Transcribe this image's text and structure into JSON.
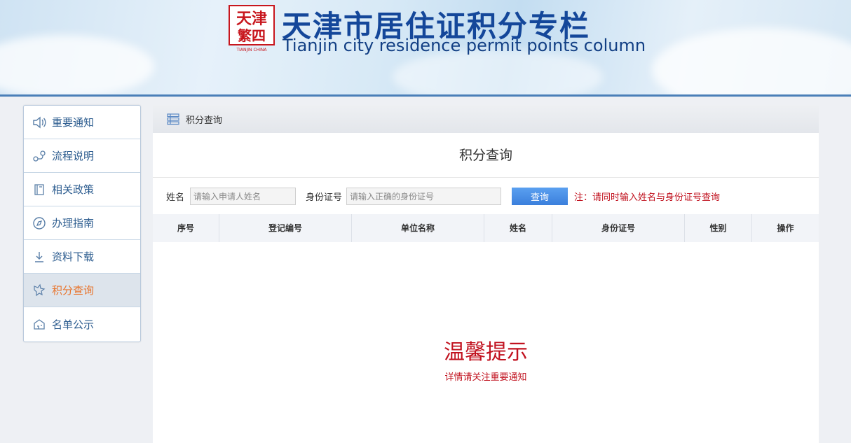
{
  "header": {
    "logo_text_top": "天津",
    "logo_text_mid": "繁四",
    "logo_text_bottom": "TIANJIN CHINA",
    "title_cn": "天津市居住证积分专栏",
    "title_en": "Tianjin city residence permit points column"
  },
  "sidebar": {
    "items": [
      {
        "label": "重要通知",
        "icon": "speaker-icon",
        "active": false
      },
      {
        "label": "流程说明",
        "icon": "flow-icon",
        "active": false
      },
      {
        "label": "相关政策",
        "icon": "policy-icon",
        "active": false
      },
      {
        "label": "办理指南",
        "icon": "compass-icon",
        "active": false
      },
      {
        "label": "资料下载",
        "icon": "download-icon",
        "active": false
      },
      {
        "label": "积分查询",
        "icon": "query-icon",
        "active": true
      },
      {
        "label": "名单公示",
        "icon": "building-icon",
        "active": false
      }
    ]
  },
  "breadcrumb": {
    "label": "积分查询",
    "icon": "list-icon"
  },
  "main": {
    "title": "积分查询",
    "search": {
      "name_label": "姓名",
      "name_placeholder": "请输入申请人姓名",
      "id_label": "身份证号",
      "id_placeholder": "请输入正确的身份证号",
      "query_button": "查询",
      "note": "注：请同时输入姓名与身份证号查询"
    },
    "table": {
      "columns": [
        "序号",
        "登记编号",
        "单位名称",
        "姓名",
        "身份证号",
        "性别",
        "操作"
      ]
    },
    "tip": {
      "title": "温馨提示",
      "subtitle": "详情请关注重要通知"
    }
  },
  "colors": {
    "accent": "#3b7fdc",
    "warning": "#c1121f",
    "active_item": "#e8742c",
    "nav_text": "#2c5c8f",
    "title_blue": "#14479a"
  }
}
